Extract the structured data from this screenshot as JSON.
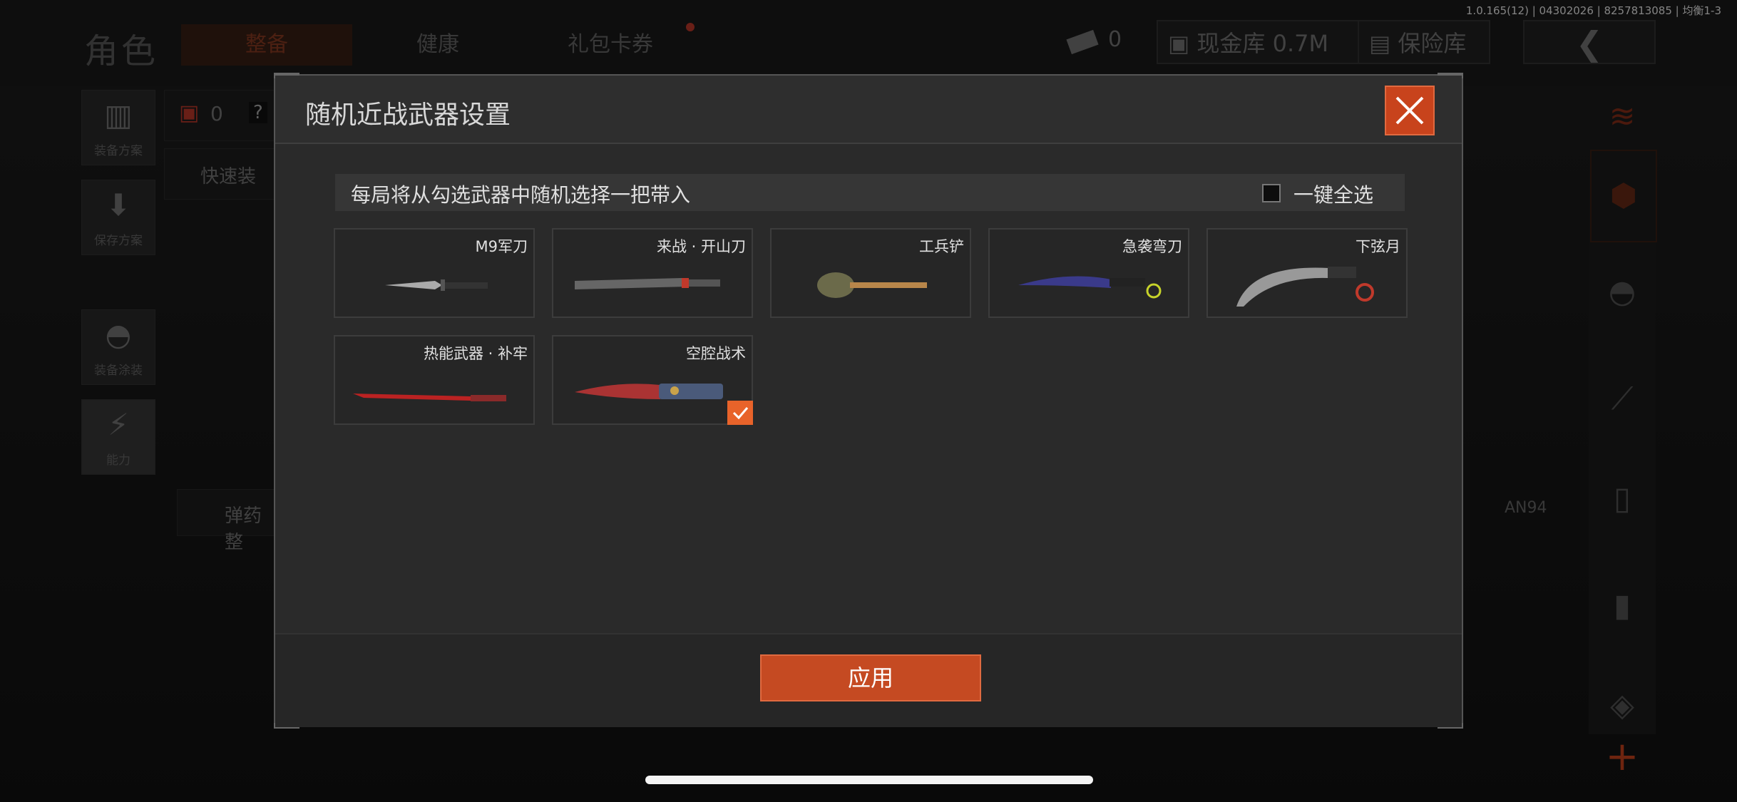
{
  "version": "1.0.165(12) | 04302026 | 8257813085 | 均衡1-3",
  "header": {
    "title": "角色",
    "tabs": [
      {
        "label": "整备",
        "active": true
      },
      {
        "label": "健康",
        "active": false
      },
      {
        "label": "礼包卡券",
        "active": false
      }
    ],
    "currency_count": "0",
    "cash_label": "现金库 0.7M",
    "safe_label": "保险库"
  },
  "left_menu": [
    {
      "label": "装备方案",
      "icon": "vest-icon"
    },
    {
      "label": "保存方案",
      "icon": "download-icon"
    },
    {
      "label": "装备涂装",
      "icon": "helmet-icon"
    },
    {
      "label": "能力",
      "icon": "lightning-icon"
    }
  ],
  "loadout": {
    "bag_count": "0",
    "help": "?",
    "quick_equip": "快速装",
    "ammo": "弹药整",
    "weapon_name": "AN94"
  },
  "modal": {
    "title": "随机近战武器设置",
    "hint": "每局将从勾选武器中随机选择一把带入",
    "select_all": "一键全选",
    "apply": "应用",
    "weapons": [
      {
        "name": "M9军刀",
        "checked": false,
        "icon": "bayonet-icon"
      },
      {
        "name": "来战 · 开山刀",
        "checked": false,
        "icon": "machete-icon"
      },
      {
        "name": "工兵铲",
        "checked": false,
        "icon": "shovel-icon"
      },
      {
        "name": "急袭弯刀",
        "checked": false,
        "icon": "curved-blade-icon"
      },
      {
        "name": "下弦月",
        "checked": false,
        "icon": "karambit-icon"
      },
      {
        "name": "热能武器 · 补牢",
        "checked": false,
        "icon": "thermal-katana-icon"
      },
      {
        "name": "空腔战术",
        "checked": true,
        "icon": "tactical-knife-icon"
      }
    ]
  },
  "colors": {
    "accent": "#c8431c",
    "check": "#e8632a"
  }
}
